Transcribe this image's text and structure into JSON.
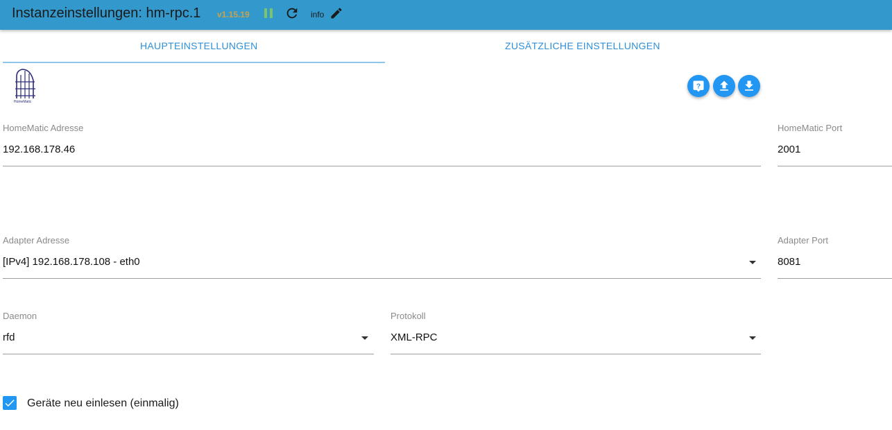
{
  "header": {
    "title": "Instanzeinstellungen: hm-rpc.1",
    "version": "v1.15.19",
    "info_label": "info"
  },
  "tabs": [
    {
      "label": "HAUPTEINSTELLUNGEN",
      "active": true
    },
    {
      "label": "ZUSÄTZLICHE EINSTELLUNGEN",
      "active": false
    }
  ],
  "logo": {
    "text": "HomeMatic"
  },
  "fields": {
    "homematic_address": {
      "label": "HomeMatic Adresse",
      "value": "192.168.178.46"
    },
    "homematic_port": {
      "label": "HomeMatic Port",
      "value": "2001"
    },
    "adapter_address": {
      "label": "Adapter Adresse",
      "value": "[IPv4] 192.168.178.108 - eth0"
    },
    "adapter_port": {
      "label": "Adapter Port",
      "value": "8081"
    },
    "daemon": {
      "label": "Daemon",
      "value": "rfd"
    },
    "protocol": {
      "label": "Protokoll",
      "value": "XML-RPC"
    }
  },
  "checkbox": {
    "label": "Geräte neu einlesen (einmalig)",
    "checked": true
  },
  "colors": {
    "header": "#3399cc",
    "accent": "#2196f3",
    "version": "#c9a24a",
    "pause": "#7cc36b"
  },
  "icons": [
    "pause-icon",
    "refresh-icon",
    "edit-icon",
    "help-icon",
    "upload-icon",
    "download-icon",
    "check-icon",
    "dropdown-caret-icon"
  ]
}
